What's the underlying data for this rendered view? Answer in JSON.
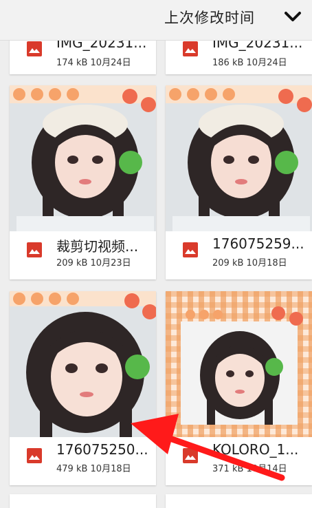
{
  "header": {
    "sort_label": "上次修改时间",
    "sort_icon": "chevron-down-icon"
  },
  "files": [
    {
      "name": "IMG_20231...",
      "meta": "174 kB 10月24日"
    },
    {
      "name": "IMG_20231...",
      "meta": "186 kB 10月24日"
    },
    {
      "name": "裁剪切视频...",
      "meta": "209 kB 10月23日"
    },
    {
      "name": "176075259...",
      "meta": "209 kB 10月18日"
    },
    {
      "name": "176075250...",
      "meta": "479 kB 10月18日"
    },
    {
      "name": "KOLORO_1...",
      "meta": "371 kB 10月14日"
    }
  ],
  "colors": {
    "file_icon": "#d93a2b",
    "arrow": "#ff1a1a",
    "check_orange": "#f0a060"
  }
}
